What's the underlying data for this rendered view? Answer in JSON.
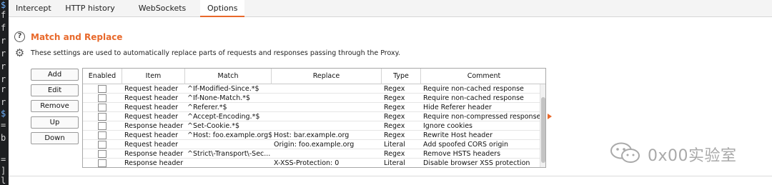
{
  "terminal": {
    "lines": [
      "$",
      "f",
      "f",
      "r",
      "r",
      "r",
      "r",
      "r",
      "r",
      "$",
      "=",
      "b",
      "=",
      "]",
      "l"
    ]
  },
  "tabs": [
    {
      "label": "Intercept",
      "active": false
    },
    {
      "label": "HTTP history",
      "active": false
    },
    {
      "label": "WebSockets history",
      "active": false
    },
    {
      "label": "Options",
      "active": true
    }
  ],
  "section": {
    "title": "Match and Replace",
    "description": "These settings are used to automatically replace parts of requests and responses passing through the Proxy."
  },
  "buttons": {
    "add": "Add",
    "edit": "Edit",
    "remove": "Remove",
    "up": "Up",
    "down": "Down"
  },
  "table": {
    "headers": [
      "Enabled",
      "Item",
      "Match",
      "Replace",
      "Type",
      "Comment"
    ],
    "rows": [
      {
        "enabled": false,
        "item": "Request header",
        "match": "^If-Modified-Since.*$",
        "replace": "",
        "type": "Regex",
        "comment": "Require non-cached response"
      },
      {
        "enabled": false,
        "item": "Request header",
        "match": "^If-None-Match.*$",
        "replace": "",
        "type": "Regex",
        "comment": "Require non-cached response"
      },
      {
        "enabled": false,
        "item": "Request header",
        "match": "^Referer.*$",
        "replace": "",
        "type": "Regex",
        "comment": "Hide Referer header"
      },
      {
        "enabled": false,
        "item": "Request header",
        "match": "^Accept-Encoding.*$",
        "replace": "",
        "type": "Regex",
        "comment": "Require non-compressed responses"
      },
      {
        "enabled": false,
        "item": "Response header",
        "match": "^Set-Cookie.*$",
        "replace": "",
        "type": "Regex",
        "comment": "Ignore cookies"
      },
      {
        "enabled": false,
        "item": "Request header",
        "match": "^Host: foo.example.org$",
        "replace": "Host: bar.example.org",
        "type": "Regex",
        "comment": "Rewrite Host header"
      },
      {
        "enabled": false,
        "item": "Request header",
        "match": "",
        "replace": "Origin: foo.example.org",
        "type": "Literal",
        "comment": "Add spoofed CORS origin"
      },
      {
        "enabled": false,
        "item": "Response header",
        "match": "^Strict\\-Transport\\-Sec...",
        "replace": "",
        "type": "Regex",
        "comment": "Remove HSTS headers"
      },
      {
        "enabled": false,
        "item": "Response header",
        "match": "",
        "replace": "X-XSS-Protection: 0",
        "type": "Literal",
        "comment": "Disable browser XSS protection"
      }
    ]
  },
  "watermark": {
    "text": "0x00实验室",
    "icon": "wechat-icon"
  },
  "colors": {
    "accent": "#e8692b",
    "terminal_bg": "#1d1f21"
  }
}
